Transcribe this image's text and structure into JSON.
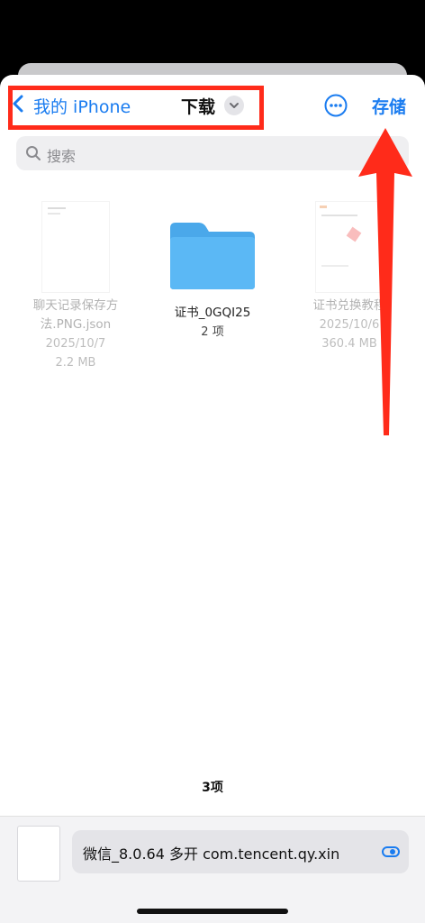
{
  "header": {
    "back_label": "我的 iPhone",
    "folder_title": "下载",
    "save_label": "存储"
  },
  "search": {
    "placeholder": "搜索"
  },
  "files": [
    {
      "name_line1": "聊天记录保存方",
      "name_line2": "法.PNG.json",
      "date": "2025/10/7",
      "size": "2.2 MB",
      "dimmed": true
    },
    {
      "name_line1": "证书_0GQI25",
      "items": "2 项",
      "dimmed": false
    },
    {
      "name_line1": "证书兑换教程",
      "date": "2025/10/6",
      "size": "360.4 MB",
      "dimmed": true
    }
  ],
  "item_count": "3项",
  "bottom": {
    "filename": "微信_8.0.64 多开 com.tencent.qy.xin"
  },
  "colors": {
    "accent": "#1a7cf0",
    "highlight": "#ff2b1a",
    "folder": "#5bb8f5"
  }
}
